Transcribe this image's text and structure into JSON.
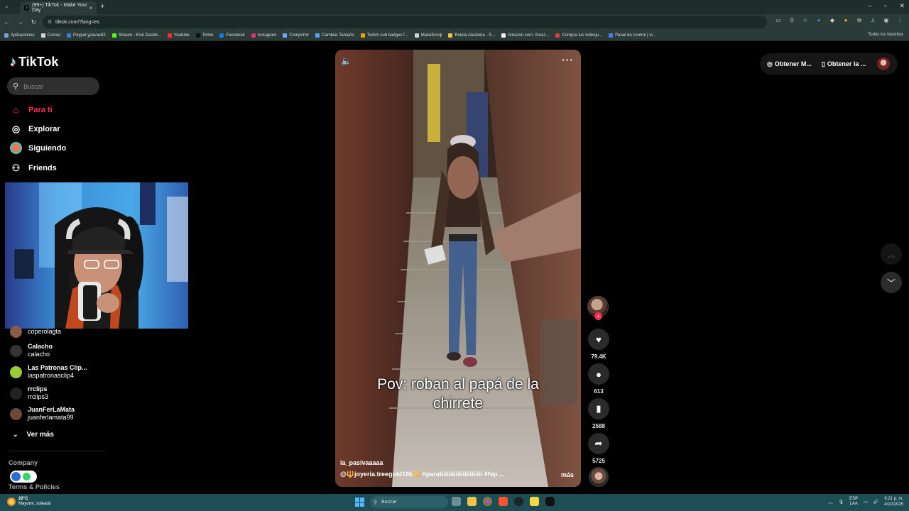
{
  "browser": {
    "tab_title": "(99+) TikTok - Make Your Day",
    "url": "tiktok.com/?lang=es",
    "bookmarks": [
      {
        "label": "Aplicaciones",
        "color": "#7aa0d8"
      },
      {
        "label": "Correo",
        "color": "#d6d6d6"
      },
      {
        "label": "Paypal ypavas92",
        "color": "#3b7bd4"
      },
      {
        "label": "Stream - Kick Dashb...",
        "color": "#53fc18"
      },
      {
        "label": "Youtube",
        "color": "#ff2b2b"
      },
      {
        "label": "Tiktok",
        "color": "#111111"
      },
      {
        "label": "Facebook",
        "color": "#1877f2"
      },
      {
        "label": "Instagram",
        "color": "#e1306c"
      },
      {
        "label": "Comprimir",
        "color": "#6fa8ff"
      },
      {
        "label": "Cambiar Tamaño",
        "color": "#5fa0ff"
      },
      {
        "label": "Twitch sub badges f...",
        "color": "#f39c12"
      },
      {
        "label": "MakeEmoji",
        "color": "#d0d0d0"
      },
      {
        "label": "Ruleta Aleatoria - S...",
        "color": "#f0c040"
      },
      {
        "label": "Amazon.com: Amaz...",
        "color": "#f0f0f0"
      },
      {
        "label": "Compra tus videoju...",
        "color": "#e03c3c"
      },
      {
        "label": "Panel de control | vi...",
        "color": "#4b7bec"
      }
    ],
    "all_bookmarks": "Todos los favoritos"
  },
  "sidebar": {
    "logo": "TikTok",
    "search_placeholder": "Buscar",
    "nav": [
      {
        "label": "Para ti",
        "icon": "home-icon"
      },
      {
        "label": "Explorar",
        "icon": "compass-icon"
      },
      {
        "label": "Siguiendo",
        "icon": "following-avatar-icon"
      },
      {
        "label": "Friends",
        "icon": "friends-icon"
      }
    ],
    "following": [
      {
        "name": "",
        "handle": "coperolagta",
        "color": "#8a5a4a"
      },
      {
        "name": "Calacho",
        "handle": "calacho",
        "color": "#333333"
      },
      {
        "name": "Las Patronas Clip...",
        "handle": "laspatronasclip4",
        "color": "#9acd32"
      },
      {
        "name": "rrclips",
        "handle": "rrclips3",
        "color": "#222222"
      },
      {
        "name": "JuanFerLaMata",
        "handle": "juanferlamata99",
        "color": "#6b4a3c"
      }
    ],
    "ver_mas": "Ver más",
    "company": "Company",
    "terms": "Terms & Policies"
  },
  "video": {
    "caption": "Pov: roban al papá de la chirrete",
    "author": "la_pasivaaaaa",
    "description_mention": "@🔱joyeria.treegold18k🔱",
    "description_tags": "#paratiiiiiiiiiiiiiiiiiiiiiii #fvp ...",
    "more": "más"
  },
  "actions": {
    "likes": "79.4K",
    "comments": "613",
    "saves": "2588",
    "shares": "5725"
  },
  "topright": {
    "item1": "Obtener M...",
    "item2": "Obtener la ..."
  },
  "taskbar": {
    "temp": "20°C",
    "weather": "Mayorm. soleado",
    "search": "Buscar",
    "lang1": "ESP",
    "lang2": "LAA",
    "time": "6:21 p. m.",
    "date": "4/10/2025"
  }
}
